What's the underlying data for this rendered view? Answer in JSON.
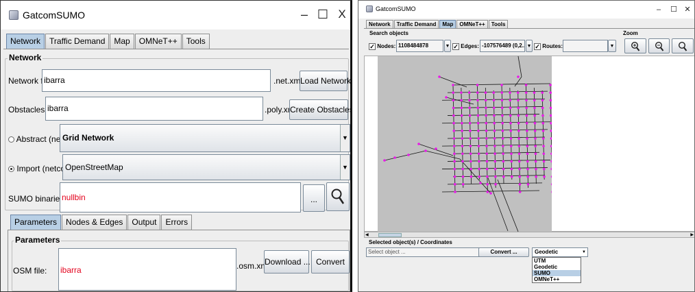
{
  "left": {
    "title": "GatcomSUMO",
    "window_buttons": {
      "minimize": "–",
      "maximize": "☐",
      "close": "X"
    },
    "tabs": [
      "Network",
      "Traffic Demand",
      "Map",
      "OMNeT++",
      "Tools"
    ],
    "network_group": "Network",
    "network_file": {
      "label": "Network file:",
      "value": "ibarra",
      "suffix": ".net.xml",
      "button": "Load Network"
    },
    "obstacles_file": {
      "label": "Obstacles file:",
      "value": "ibarra",
      "suffix": ".poly.xml",
      "button": "Create Obstacles"
    },
    "abstract": {
      "label": "Abstract (netgen):",
      "value": "Grid Network",
      "selected": false
    },
    "import": {
      "label": "Import (netconvert):",
      "value": "OpenStreetMap",
      "selected": true
    },
    "sumo_binaries": {
      "label": "SUMO binaries path:",
      "value": "nullbin",
      "browse": "..."
    },
    "subtabs": [
      "Parameters",
      "Nodes & Edges",
      "Output",
      "Errors"
    ],
    "parameters_group": "Parameters",
    "osm": {
      "label": "OSM file:",
      "value": "ibarra",
      "suffix": ".osm.xml",
      "download": "Download ...",
      "convert": "Convert"
    }
  },
  "right": {
    "title": "GatcomSUMO",
    "window_buttons": {
      "minimize": "–",
      "maximize": "☐",
      "close": "✕"
    },
    "tabs": [
      "Network",
      "Traffic Demand",
      "Map",
      "OMNeT++",
      "Tools"
    ],
    "search_group": "Search objects",
    "zoom_group": "Zoom",
    "nodes": {
      "label": "Nodes:",
      "value": "1108484878",
      "checked": true
    },
    "edges": {
      "label": "Edges:",
      "value": "-107576489 (0,2...",
      "checked": true
    },
    "routes": {
      "label": "Routes:",
      "value": "",
      "checked": true
    },
    "selected_group": "Selected object(s) / Coordinates",
    "select_field": "Select object ...",
    "convert_button": "Convert ...",
    "coord_combo": "Geodetic",
    "coord_options": [
      "UTM",
      "Geodetic",
      "SUMO",
      "OMNeT++"
    ],
    "coord_selected_index": 2,
    "colors": {
      "node": "#e81be8",
      "map_bg": "#c0c0c0",
      "tab_selected": "#b8cfe5"
    }
  }
}
